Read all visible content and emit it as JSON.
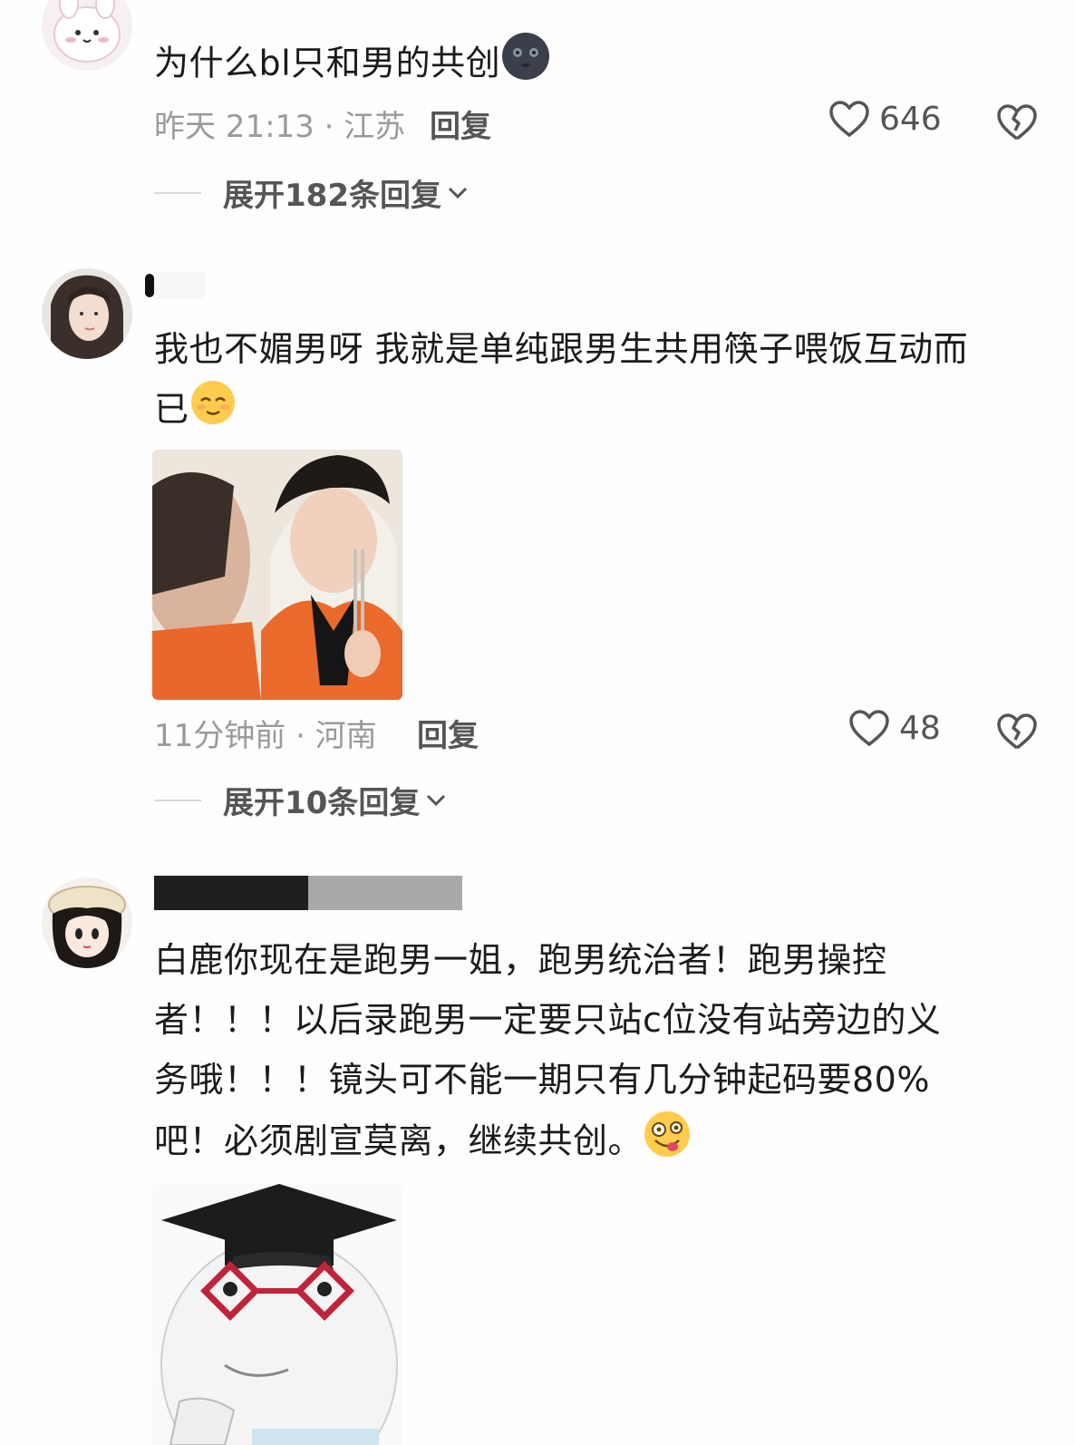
{
  "comments": [
    {
      "text": "为什么bl只和男的共创",
      "time_location": "昨天 21:13 · 江苏",
      "reply_label": "回复",
      "likes": "646",
      "expand_label": "展开182条回复",
      "trailing_emoji": "dark-moon-face-icon"
    },
    {
      "text_line1": "我也不媚男呀 我就是单纯跟男生共用筷子喂饭互动而",
      "text_line2": "已",
      "time_location": "11分钟前 · 河南",
      "reply_label": "回复",
      "likes": "48",
      "expand_label": "展开10条回复",
      "trailing_emoji": "relieved-face-icon"
    },
    {
      "text_line1": "白鹿你现在是跑男一姐，跑男统治者！跑男操控",
      "text_line2": "者！！！以后录跑男一定要只站c位没有站旁边的义",
      "text_line3": "务哦！！！镜头可不能一期只有几分钟起码要80%",
      "text_line4": "吧！必须剧宣莫离，继续共创。",
      "trailing_emoji": "zany-face-icon"
    }
  ],
  "colors": {
    "background": "#fefefe",
    "text": "#1b1b1b",
    "meta": "#9a9a9a",
    "action": "#555555",
    "divider": "#d8d8d8"
  }
}
